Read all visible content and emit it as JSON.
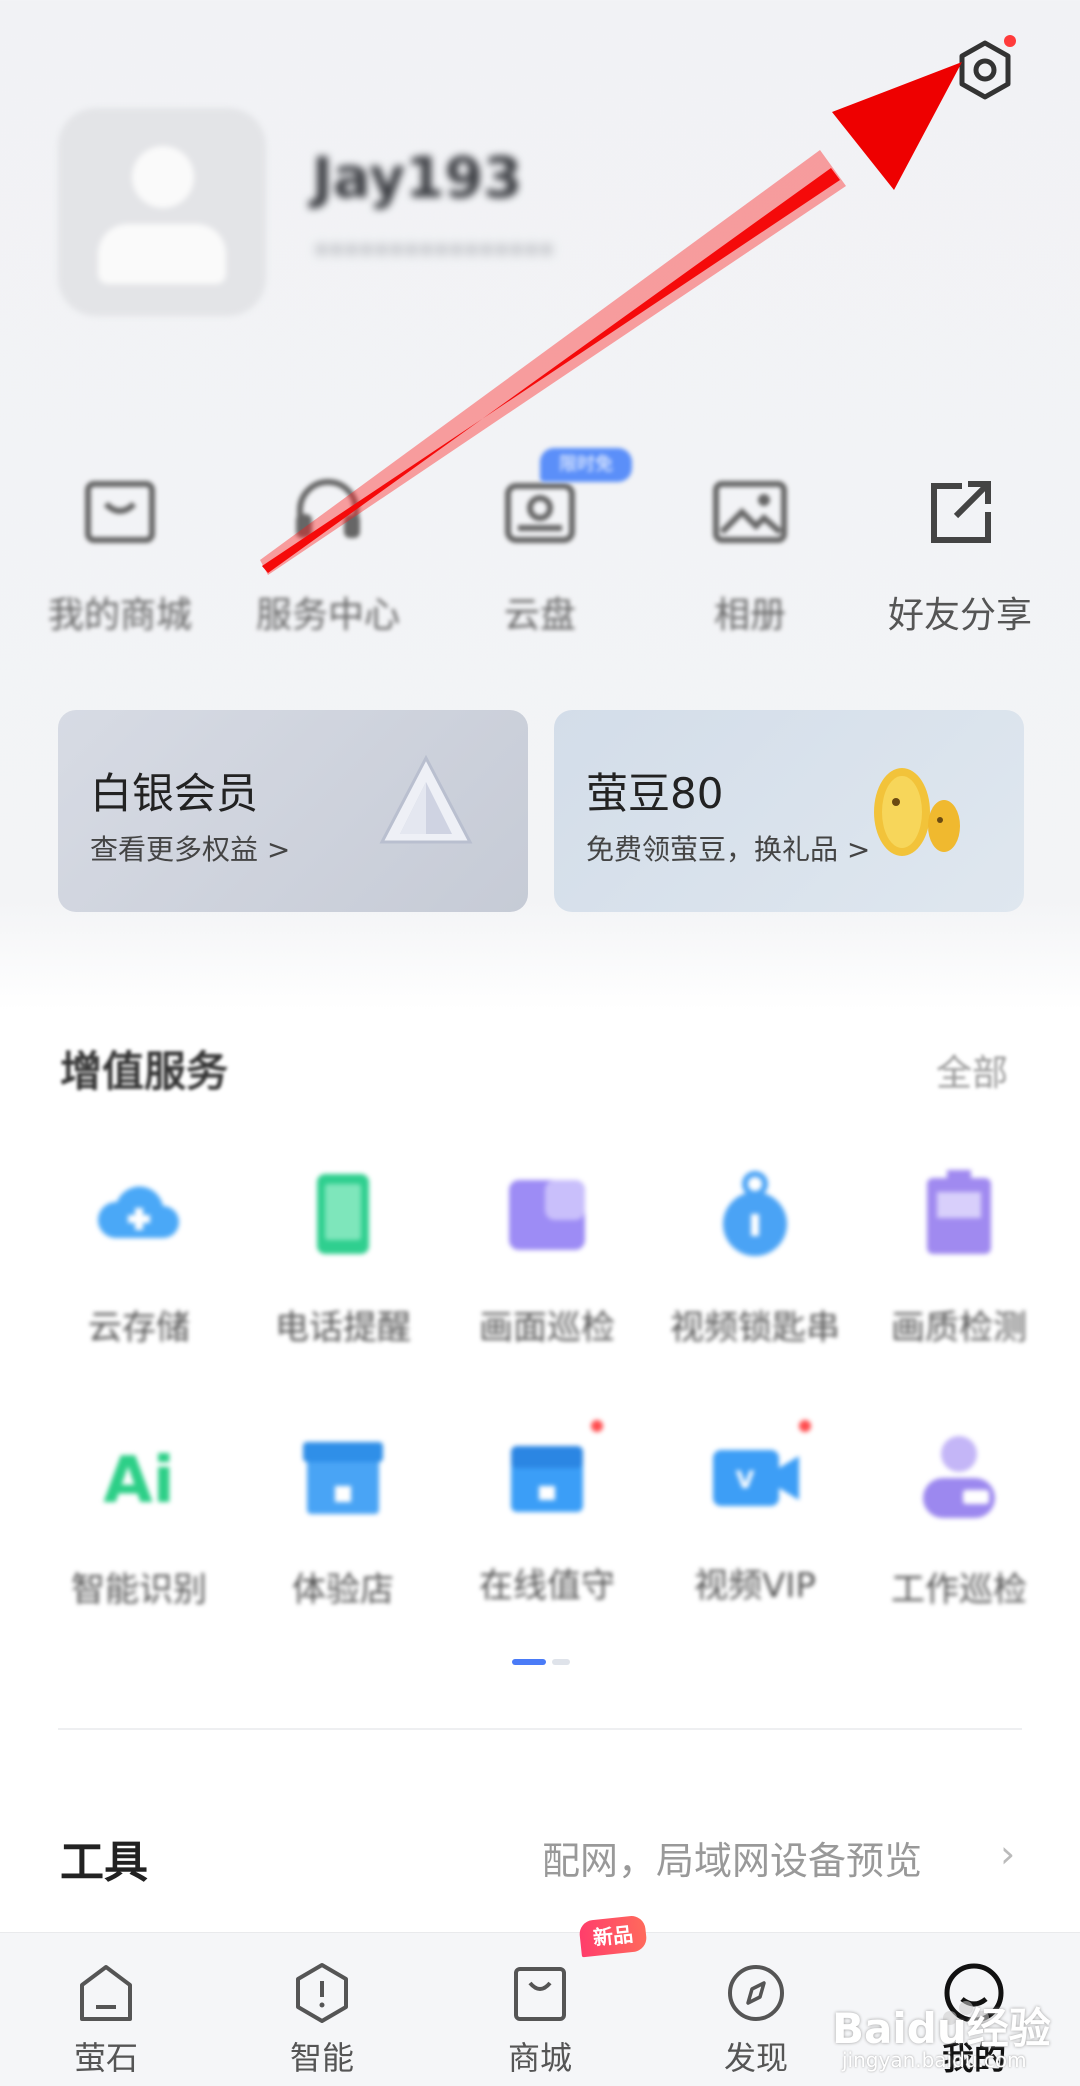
{
  "header": {
    "settings_icon": "gear-icon",
    "user_name": "Jay193",
    "user_sub": "****************"
  },
  "quick_actions": [
    {
      "label": "我的商城",
      "icon": "mall-icon"
    },
    {
      "label": "服务中心",
      "icon": "headset-icon"
    },
    {
      "label": "云盘",
      "icon": "cloud-disk-icon",
      "badge": "限时免"
    },
    {
      "label": "相册",
      "icon": "album-icon"
    },
    {
      "label": "好友分享",
      "icon": "share-icon"
    }
  ],
  "cards": {
    "member": {
      "title": "白银会员",
      "subtitle": "查看更多权益",
      "chevron": ">"
    },
    "beans": {
      "title": "萤豆80",
      "subtitle": "免费领萤豆，换礼品",
      "chevron": ">"
    }
  },
  "value_services": {
    "title": "增值服务",
    "all_label": "全部",
    "items": [
      {
        "label": "云存储",
        "icon": "cloud-storage-icon",
        "color": "#4aa8f7"
      },
      {
        "label": "电话提醒",
        "icon": "phone-icon",
        "color": "#2fcf8f"
      },
      {
        "label": "画面巡检",
        "icon": "screen-check-icon",
        "color": "#9d8cf5"
      },
      {
        "label": "视频锁匙串",
        "icon": "video-key-icon",
        "color": "#4aa3f5"
      },
      {
        "label": "画质检测",
        "icon": "quality-check-icon",
        "color": "#a08af0"
      },
      {
        "label": "智能识别",
        "icon": "ai-icon",
        "color": "#2ccf87"
      },
      {
        "label": "体验店",
        "icon": "store-icon",
        "color": "#49a4f5"
      },
      {
        "label": "在线值守",
        "icon": "online-guard-icon",
        "color": "#3b9ef7"
      },
      {
        "label": "视频VIP",
        "icon": "video-vip-icon",
        "color": "#3d9ef6"
      },
      {
        "label": "工作巡检",
        "icon": "work-inspect-icon",
        "color": "#9c88ef"
      }
    ]
  },
  "tools": {
    "title": "工具",
    "description": "配网，局域网设备预览",
    "chevron": "›"
  },
  "bottom_nav": {
    "badge": "新品",
    "tabs": [
      {
        "label": "萤石",
        "icon": "home-icon"
      },
      {
        "label": "智能",
        "icon": "smart-icon"
      },
      {
        "label": "商城",
        "icon": "shop-bag-icon"
      },
      {
        "label": "发现",
        "icon": "compass-icon"
      },
      {
        "label": "我的",
        "icon": "profile-icon"
      }
    ]
  },
  "watermark": {
    "text": "Baidu经验",
    "sub": "jingyan.baidu.com"
  },
  "colors": {
    "arrow": "#ee0000",
    "accent": "#4a7bf7",
    "badge_red": "#ff3d6b"
  }
}
